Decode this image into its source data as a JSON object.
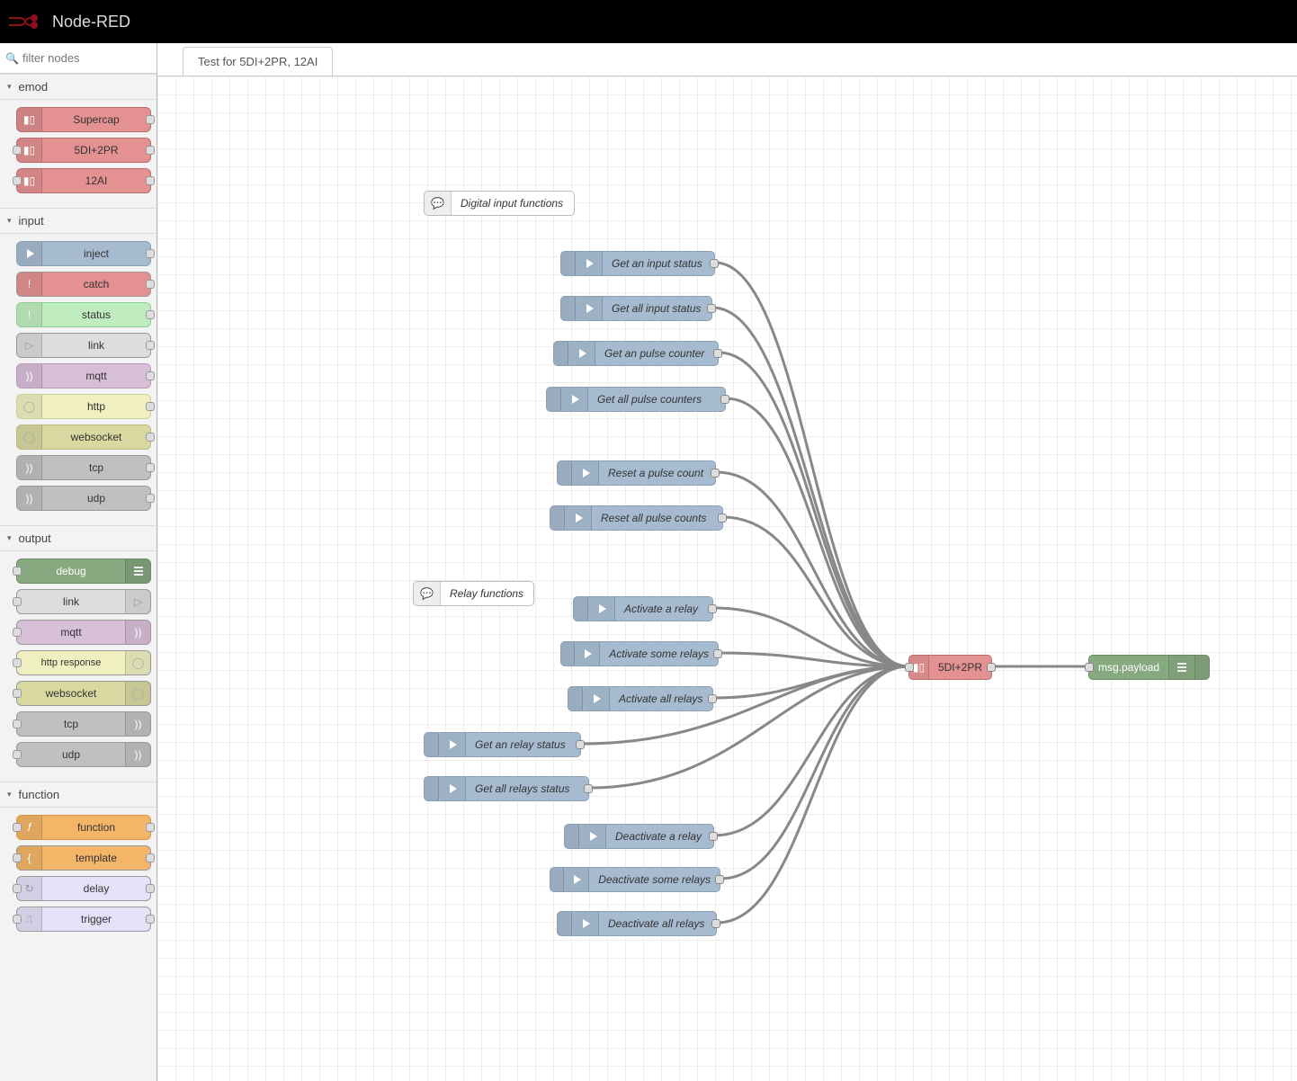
{
  "app_title": "Node-RED",
  "search_placeholder": "filter nodes",
  "tab_name": "Test for 5DI+2PR, 12AI",
  "palette": {
    "cat_emod": "emod",
    "cat_input": "input",
    "cat_output": "output",
    "cat_function": "function",
    "emod": {
      "supercap": "Supercap",
      "fivedi": "5DI+2PR",
      "twelveai": "12AI"
    },
    "input": {
      "inject": "inject",
      "catch": "catch",
      "status": "status",
      "link": "link",
      "mqtt": "mqtt",
      "http": "http",
      "websocket": "websocket",
      "tcp": "tcp",
      "udp": "udp"
    },
    "output": {
      "debug": "debug",
      "link": "link",
      "mqtt": "mqtt",
      "httpresponse": "http response",
      "websocket": "websocket",
      "tcp": "tcp",
      "udp": "udp"
    },
    "function": {
      "function": "function",
      "template": "template",
      "delay": "delay",
      "trigger": "trigger"
    }
  },
  "flow": {
    "comment_di": "Digital input functions",
    "comment_relay": "Relay functions",
    "inj_get_input_status": "Get an input status",
    "inj_get_all_input_status": "Get all input status",
    "inj_get_pulse_counter": "Get an pulse counter",
    "inj_get_all_pulse_counters": "Get all pulse counters",
    "inj_reset_pulse_count": "Reset a pulse count",
    "inj_reset_all_pulse": "Reset all pulse counts",
    "inj_activate_relay": "Activate a relay",
    "inj_activate_some": "Activate some relays",
    "inj_activate_all": "Activate all relays",
    "inj_get_relay_status": "Get an relay status",
    "inj_get_all_relays": "Get all relays status",
    "inj_deact_relay": "Deactivate a relay",
    "inj_deact_some": "Deactivate some relays",
    "inj_deact_all": "Deactivate all relays",
    "target_node": "5DI+2PR",
    "debug_node": "msg.payload"
  }
}
